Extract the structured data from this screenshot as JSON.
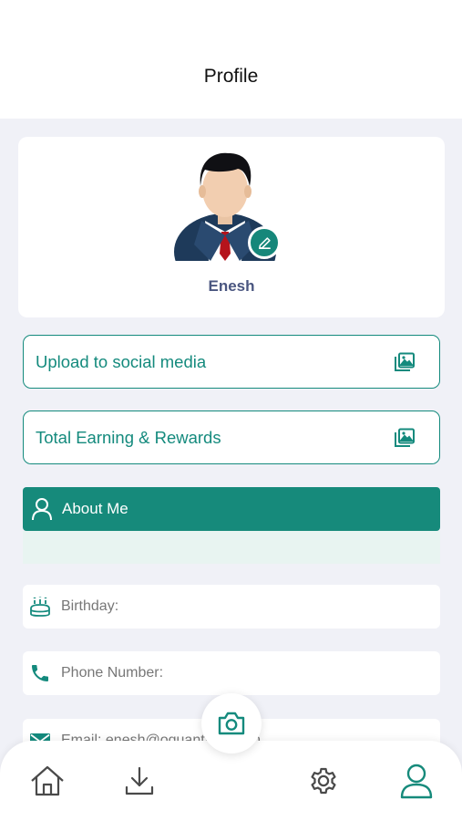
{
  "header": {
    "title": "Profile"
  },
  "profile": {
    "name": "Enesh",
    "avatar_icon": "user-avatar-suit",
    "edit_icon": "pencil-icon"
  },
  "actions": [
    {
      "label": "Upload to social media",
      "icon": "gallery-icon"
    },
    {
      "label": "Total Earning & Rewards",
      "icon": "gallery-icon"
    }
  ],
  "about": {
    "title": "About Me",
    "icon": "person-icon"
  },
  "info": {
    "birthday": "Birthday:",
    "phone": "Phone Number:",
    "email": "Email: enesh@oquantapp.com"
  },
  "tabbar": {
    "items": [
      "home-icon",
      "download-icon",
      "settings-icon",
      "profile-icon"
    ],
    "active": "profile-icon",
    "center": "camera-icon"
  },
  "colors": {
    "accent": "#168a7b",
    "name": "#4a5680",
    "background": "#f0f1f7"
  }
}
